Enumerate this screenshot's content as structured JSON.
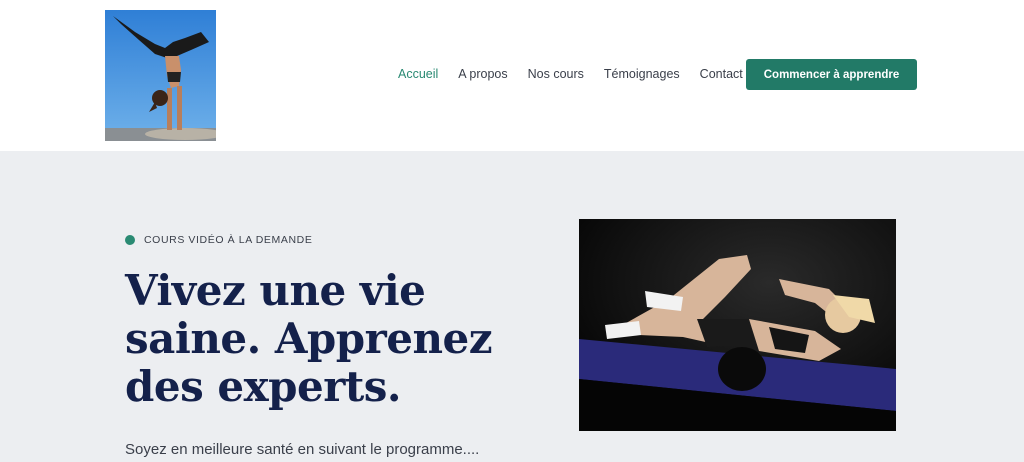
{
  "header": {
    "logo_alt": "yoga handstand photo",
    "nav": [
      {
        "label": "Accueil",
        "active": true
      },
      {
        "label": "A propos",
        "active": false
      },
      {
        "label": "Nos cours",
        "active": false
      },
      {
        "label": "Témoignages",
        "active": false
      },
      {
        "label": "Contact",
        "active": false
      }
    ],
    "cta_label": "Commencer à apprendre"
  },
  "hero": {
    "eyebrow": "COURS VIDÉO À LA DEMANDE",
    "headline_lines": [
      "Vivez une vie",
      "saine. Apprenez",
      "des experts."
    ],
    "subtext": "Soyez en meilleure santé en suivant le programme....",
    "image_alt": "woman doing crunches on a fitness mat"
  },
  "colors": {
    "accent": "#227a67",
    "headline": "#14214b",
    "hero_bg": "#eceef1"
  }
}
